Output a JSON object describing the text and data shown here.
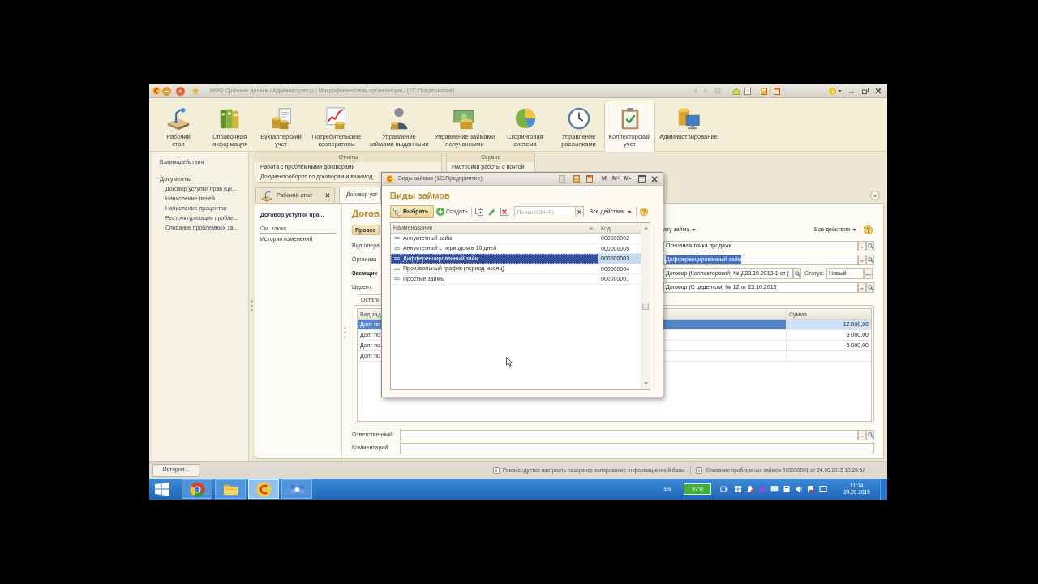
{
  "window": {
    "title": "МФО Срочные деньги / Администратор / Микрофинансовая организация / (1С:Предприятие)"
  },
  "sections": [
    {
      "label": "Рабочий\nстол",
      "selected": false
    },
    {
      "label": "Справочная\nинформация",
      "selected": false
    },
    {
      "label": "Бухгалтерский\nучет",
      "selected": false
    },
    {
      "label": "Потребительские\nкооперативы",
      "selected": false
    },
    {
      "label": "Управление\nзаймами выданными",
      "selected": false
    },
    {
      "label": "Управление займами\nполученными",
      "selected": false
    },
    {
      "label": "Скоринговая\nсистема",
      "selected": false
    },
    {
      "label": "Управление\nрассылками",
      "selected": false
    },
    {
      "label": "Коллекторский\nучет",
      "selected": true
    },
    {
      "label": "Администрирование",
      "selected": false
    }
  ],
  "function_panel": {
    "links": [
      "Взаимодействия"
    ],
    "groups": [
      {
        "title": "Документы",
        "items": [
          "Договор уступки прав (це...",
          "Начисление пеней",
          "Начисление процентов",
          "Реструктуризация пробле...",
          "Списание проблемных за..."
        ]
      }
    ]
  },
  "report_groups": [
    {
      "title": "Отчеты",
      "items": [
        "Работа с проблемными договорами",
        "Документооборот по договорам и взаимод"
      ]
    },
    {
      "title": "Сервис",
      "items": [
        "Настройки работы с почтой"
      ]
    }
  ],
  "tabs": [
    {
      "label": "Рабочий стол",
      "selected": false,
      "closable": true
    },
    {
      "label": "Договор уст",
      "selected": true,
      "closable": false
    }
  ],
  "document": {
    "nav": {
      "title": "Договор уступки пра...",
      "see_also": "См. также",
      "links": [
        "История изменений"
      ]
    },
    "title": "Догов",
    "post_button": "Провес",
    "menu_fragment": "ату займа",
    "all_actions": "Все действия",
    "fields": [
      {
        "kind": "lookup",
        "label": "Вид опера",
        "bold": false,
        "value": "Основная точка продажи",
        "highlighted": false
      },
      {
        "kind": "lookup",
        "label": "Организа",
        "bold": false,
        "value": "Дифференцированный займ",
        "highlighted": true
      },
      {
        "kind": "status",
        "label": "Заемщик",
        "bold": true,
        "value": "Договор (Коллекторский) № Д23.10.2013-1 от (",
        "highlighted": false,
        "status_label": "Статус:",
        "status_value": "Новый"
      },
      {
        "kind": "lookup",
        "label": "Цедент:",
        "bold": false,
        "value": "Договор (С цедентом) № 12 от 23.10.2013",
        "highlighted": false
      }
    ],
    "balances": {
      "tab": "Остатк",
      "columns": [
        "Вид зад",
        "Сумма"
      ],
      "rows": [
        {
          "cells": [
            "Долг по",
            "12 000,00"
          ],
          "selected": true
        },
        {
          "cells": [
            "Долг по",
            "3 000,00"
          ],
          "selected": false
        },
        {
          "cells": [
            "Долг по",
            "5 000,00"
          ],
          "selected": false
        },
        {
          "cells": [
            "Долг по"
          ],
          "selected": false
        }
      ]
    },
    "footer_fields": [
      {
        "kind": "lookup",
        "label": "Ответственный:"
      },
      {
        "kind": "text",
        "label": "Комментарий:"
      }
    ]
  },
  "dialog": {
    "title": "Виды займов (1С:Предприятие)",
    "title_buttons": [
      "M",
      "M+",
      "M-"
    ],
    "heading": "Виды займов",
    "select_button": "Выбрать",
    "create_button": "Создать",
    "search": {
      "placeholder": "Поиск (Ctrl+F)"
    },
    "all_actions": "Все действия",
    "table": {
      "columns": [
        "Наименование",
        "Код"
      ],
      "rows": [
        {
          "name": "Аннуитетный займ",
          "code": "000000002",
          "selected": false
        },
        {
          "name": "Аннуитетный с периодом в 10 дней",
          "code": "000000005",
          "selected": false
        },
        {
          "name": "Дифференцированный займ",
          "code": "000000003",
          "selected": true
        },
        {
          "name": "Произвольный график (период месяц)",
          "code": "000000004",
          "selected": false
        },
        {
          "name": "Простые займы",
          "code": "000000001",
          "selected": false
        }
      ]
    }
  },
  "status_bar": {
    "history_button": "История...",
    "messages": [
      "Рекомендуется настроить резервное копирование информационной базы.",
      "Списание проблемных займов 000000001 от 24.09.2015 10:26:52"
    ]
  },
  "taskbar": {
    "apps": [
      {
        "selected": false
      },
      {
        "selected": false
      },
      {
        "selected": true
      },
      {
        "selected": false
      }
    ],
    "language": "EN",
    "battery": "97%",
    "time": "11:14",
    "date": "24.09.2015"
  }
}
